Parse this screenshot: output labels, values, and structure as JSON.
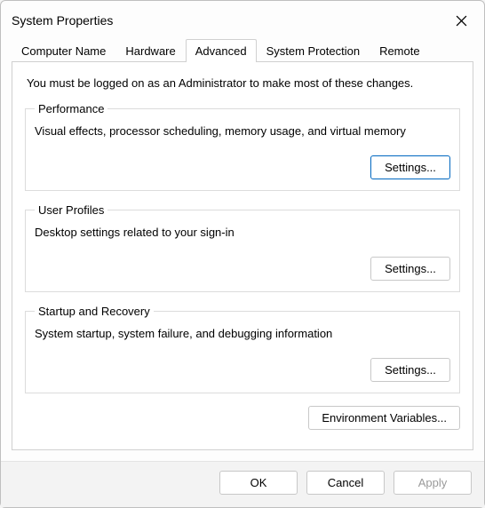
{
  "window": {
    "title": "System Properties"
  },
  "tabs": [
    {
      "label": "Computer Name"
    },
    {
      "label": "Hardware"
    },
    {
      "label": "Advanced"
    },
    {
      "label": "System Protection"
    },
    {
      "label": "Remote"
    }
  ],
  "active_tab": 2,
  "info_line": "You must be logged on as an Administrator to make most of these changes.",
  "groups": {
    "performance": {
      "title": "Performance",
      "desc": "Visual effects, processor scheduling, memory usage, and virtual memory",
      "button": "Settings..."
    },
    "user_profiles": {
      "title": "User Profiles",
      "desc": "Desktop settings related to your sign-in",
      "button": "Settings..."
    },
    "startup": {
      "title": "Startup and Recovery",
      "desc": "System startup, system failure, and debugging information",
      "button": "Settings..."
    }
  },
  "env_button": "Environment Variables...",
  "dialog": {
    "ok": "OK",
    "cancel": "Cancel",
    "apply": "Apply"
  }
}
